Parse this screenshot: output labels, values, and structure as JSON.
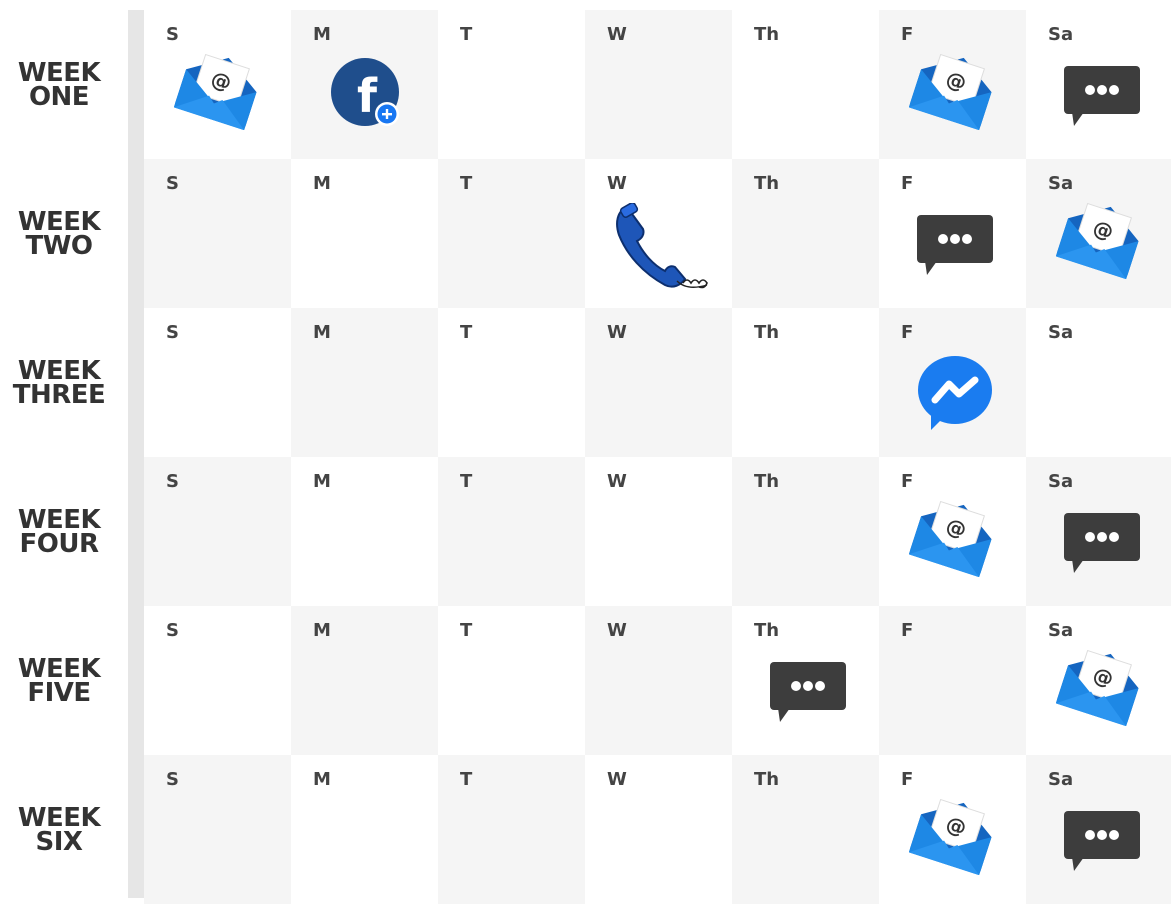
{
  "weeks": [
    {
      "line1": "WEEK",
      "line2": "ONE",
      "days": [
        {
          "label": "S",
          "icon": "email-icon"
        },
        {
          "label": "M",
          "icon": "facebook-icon"
        },
        {
          "label": "T",
          "icon": ""
        },
        {
          "label": "W",
          "icon": ""
        },
        {
          "label": "Th",
          "icon": ""
        },
        {
          "label": "F",
          "icon": "email-icon"
        },
        {
          "label": "Sa",
          "icon": "message-icon"
        }
      ]
    },
    {
      "line1": "WEEK",
      "line2": "TWO",
      "days": [
        {
          "label": "S",
          "icon": ""
        },
        {
          "label": "M",
          "icon": ""
        },
        {
          "label": "T",
          "icon": ""
        },
        {
          "label": "W",
          "icon": "phone-icon"
        },
        {
          "label": "Th",
          "icon": ""
        },
        {
          "label": "F",
          "icon": "message-icon"
        },
        {
          "label": "Sa",
          "icon": "email-icon"
        }
      ]
    },
    {
      "line1": "WEEK",
      "line2": "THREE",
      "days": [
        {
          "label": "S",
          "icon": ""
        },
        {
          "label": "M",
          "icon": ""
        },
        {
          "label": "T",
          "icon": ""
        },
        {
          "label": "W",
          "icon": ""
        },
        {
          "label": "Th",
          "icon": ""
        },
        {
          "label": "F",
          "icon": "messenger-icon"
        },
        {
          "label": "Sa",
          "icon": ""
        }
      ]
    },
    {
      "line1": "WEEK",
      "line2": "FOUR",
      "days": [
        {
          "label": "S",
          "icon": ""
        },
        {
          "label": "M",
          "icon": ""
        },
        {
          "label": "T",
          "icon": ""
        },
        {
          "label": "W",
          "icon": ""
        },
        {
          "label": "Th",
          "icon": ""
        },
        {
          "label": "F",
          "icon": "email-icon"
        },
        {
          "label": "Sa",
          "icon": "message-icon"
        }
      ]
    },
    {
      "line1": "WEEK",
      "line2": "FIVE",
      "days": [
        {
          "label": "S",
          "icon": ""
        },
        {
          "label": "M",
          "icon": ""
        },
        {
          "label": "T",
          "icon": ""
        },
        {
          "label": "W",
          "icon": ""
        },
        {
          "label": "Th",
          "icon": "message-icon"
        },
        {
          "label": "F",
          "icon": ""
        },
        {
          "label": "Sa",
          "icon": "email-icon"
        }
      ]
    },
    {
      "line1": "WEEK",
      "line2": "SIX",
      "days": [
        {
          "label": "S",
          "icon": ""
        },
        {
          "label": "M",
          "icon": ""
        },
        {
          "label": "T",
          "icon": ""
        },
        {
          "label": "W",
          "icon": ""
        },
        {
          "label": "Th",
          "icon": ""
        },
        {
          "label": "F",
          "icon": "email-icon"
        },
        {
          "label": "Sa",
          "icon": "message-icon"
        }
      ]
    }
  ],
  "colors": {
    "shade": "#f5f5f5",
    "email_blue": "#1e88e5",
    "email_blue_dark": "#1565c0",
    "facebook_blue": "#1f4e8c",
    "messenger_blue": "#1a7cf0",
    "message_gray": "#3d3d3d",
    "phone_blue": "#1e56b8",
    "label_text": "#333333"
  }
}
